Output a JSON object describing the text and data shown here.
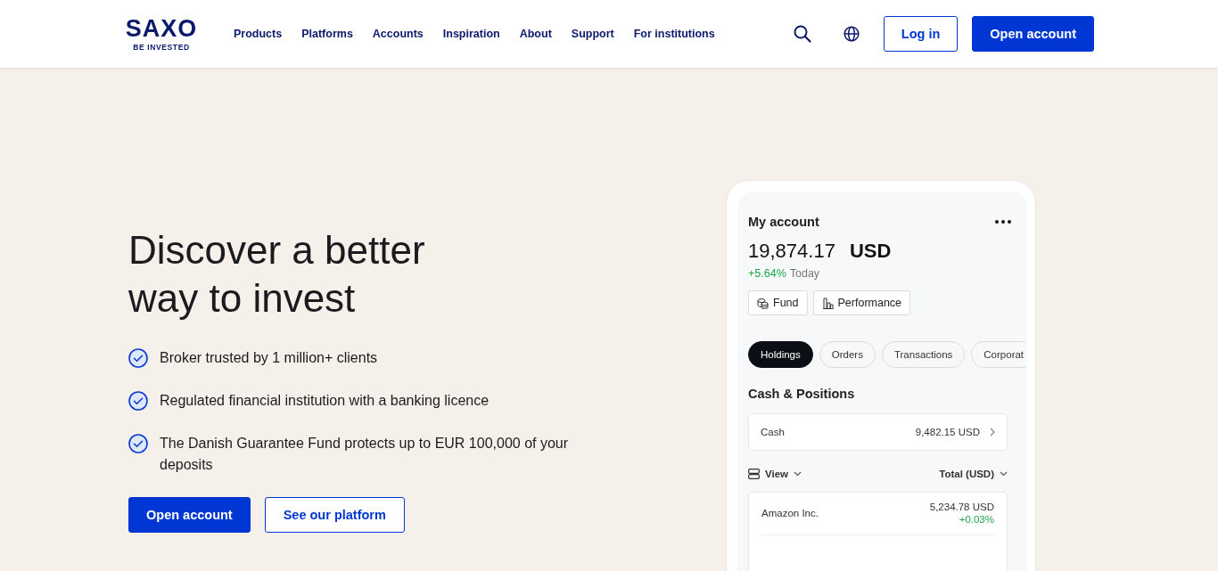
{
  "header": {
    "logo": {
      "name": "SAXO",
      "tagline": "BE INVESTED"
    },
    "nav": [
      {
        "label": "Products"
      },
      {
        "label": "Platforms"
      },
      {
        "label": "Accounts"
      },
      {
        "label": "Inspiration"
      },
      {
        "label": "About"
      },
      {
        "label": "Support"
      },
      {
        "label": "For institutions"
      }
    ],
    "login": "Log in",
    "open_account": "Open account"
  },
  "hero": {
    "heading": "Discover a better way to invest",
    "bullets": [
      "Broker trusted by 1 million+ clients",
      "Regulated financial institution with a banking licence",
      "The Danish Guarantee Fund protects up to EUR 100,000 of your deposits"
    ],
    "buttons": [
      {
        "label": "Open account",
        "kind": "primary"
      },
      {
        "label": "See our platform",
        "kind": "secondary"
      }
    ]
  },
  "phone": {
    "title": "My account",
    "balance": "19,874.17",
    "currency": "USD",
    "change": "+5.64%",
    "change_period": "Today",
    "actions": [
      {
        "label": "Fund",
        "kind": "fund"
      },
      {
        "label": "Performance",
        "kind": "performance"
      }
    ],
    "tabs": [
      {
        "label": "Holdings",
        "selected": true
      },
      {
        "label": "Orders",
        "selected": false
      },
      {
        "label": "Transactions",
        "selected": false
      },
      {
        "label": "Corporat",
        "selected": false
      }
    ],
    "section_title": "Cash & Positions",
    "cash": {
      "label": "Cash",
      "value": "9,482.15 USD"
    },
    "view_label": "View",
    "total_label": "Total (USD)",
    "positions": [
      {
        "name": "Amazon Inc.",
        "value": "5,234.78 USD",
        "change": "+0.03%"
      }
    ]
  }
}
